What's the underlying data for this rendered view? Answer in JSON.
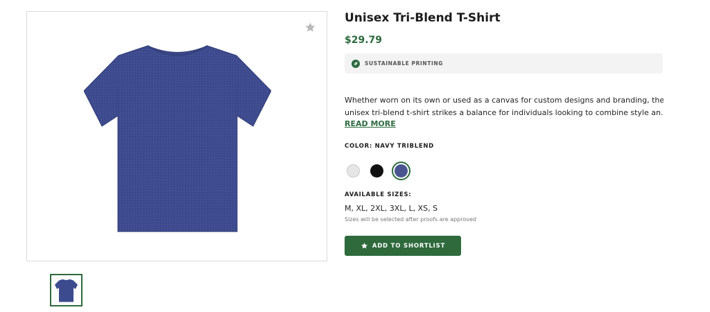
{
  "product": {
    "title": "Unisex Tri-Blend T-Shirt",
    "price": "$29.79",
    "badge": "Sustainable Printing",
    "description_line1": "Whether worn on its own or used as a canvas for custom designs and branding, the",
    "description_line2": "unisex tri-blend t-shirt strikes a balance for individuals looking to combine style an...",
    "read_more": "READ MORE",
    "color_label": "COLOR: NAVY TRIBLEND",
    "sizes_label": "AVAILABLE SIZES:",
    "sizes": "M, XL, 2XL, 3XL, L, XS, S",
    "sizes_note": "Sizes will be selected after proofs are approved",
    "shortlist_label": "ADD TO SHORTLIST"
  },
  "swatches": [
    {
      "name": "Light Grey",
      "color": "#e6e6e6",
      "selected": false
    },
    {
      "name": "Black",
      "color": "#111111",
      "selected": false
    },
    {
      "name": "Navy Triblend",
      "color": "#4a5590",
      "selected": true
    }
  ],
  "colors": {
    "accent": "#2e6a3c",
    "shirt": "#3c4a8e"
  },
  "icons": {
    "favorite": "star-icon",
    "badge": "leaf-icon",
    "button": "star-icon"
  }
}
